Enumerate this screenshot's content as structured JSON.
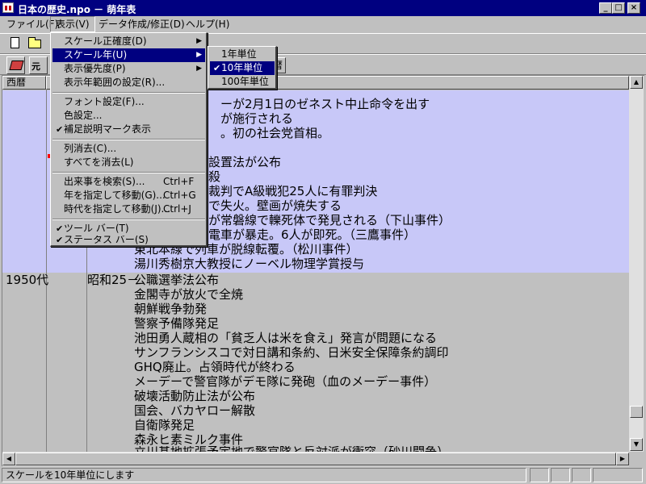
{
  "window": {
    "title": "日本の歴史.npo － 萌年表",
    "min_glyph": "_",
    "max_glyph": "□",
    "close_glyph": "×"
  },
  "menubar": [
    {
      "label": "ファイル(F)"
    },
    {
      "label": "表示(V)"
    },
    {
      "label": "データ作成/修正(D)"
    },
    {
      "label": "ヘルプ(H)"
    }
  ],
  "toolbar": {
    "era_button_label": "元",
    "era_button_right": "暦"
  },
  "columns": {
    "seireki": "西暦"
  },
  "timeline": {
    "rows_1940s": [
      "ーが2月1日のゼネスト中止命令を出す",
      "が施行される",
      "。初の社会党首相。",
      "設置法が公布",
      "殺",
      "裁判でA級戦犯25人に有罪判決",
      "で失火。壁画が焼失する",
      "が常磐線で轢死体で発見される（下山事件）",
      "電車が暴走。6人が即死。（三鷹事件）",
      "東北本線で列車が脱線転覆。（松川事件）",
      "湯川秀樹京大教授にノーベル物理学賞授与"
    ],
    "decade_1950": "1950代",
    "era_1950": "昭和25－",
    "rows_1950s": [
      "公職選挙法公布",
      "金閣寺が放火で全焼",
      "朝鮮戦争勃発",
      "警察予備隊発足",
      "池田勇人蔵相の「貧乏人は米を食え」発言が問題になる",
      "サンフランシスコで対日講和条約、日米安全保障条約調印",
      "GHQ廃止。占領時代が終わる",
      "メーデーで警官隊がデモ隊に発砲（血のメーデー事件）",
      "破壊活動防止法が公布",
      "国会、バカヤロー解散",
      "自衛隊発足",
      "森永ヒ素ミルク事件",
      "立川基地拡張予定地で警官隊と反対派が衝突（砂川闘争）"
    ]
  },
  "view_menu": {
    "items": [
      {
        "label": "スケール正確度(D)",
        "arrow": "▶"
      },
      {
        "label": "スケール年(U)",
        "arrow": "▶"
      },
      {
        "label": "表示優先度(P)",
        "arrow": "▶"
      },
      {
        "label": "表示年範囲の設定(R)..."
      },
      {
        "label": "フォント設定(F)..."
      },
      {
        "label": "色設定..."
      },
      {
        "label": "補足説明マーク表示",
        "check": "✔"
      },
      {
        "label": "列消去(C)..."
      },
      {
        "label": "すべてを消去(L)"
      },
      {
        "label": "出来事を検索(S)...",
        "shortcut": "Ctrl+F"
      },
      {
        "label": "年を指定して移動(G)...",
        "shortcut": "Ctrl+G"
      },
      {
        "label": "時代を指定して移動(J)...",
        "shortcut": "Ctrl+J"
      },
      {
        "label": "ツール バー(T)",
        "check": "✔"
      },
      {
        "label": "ステータス バー(S)",
        "check": "✔"
      }
    ]
  },
  "scale_submenu": {
    "items": [
      {
        "label": "1年単位"
      },
      {
        "label": "10年単位",
        "check": "✔"
      },
      {
        "label": "100年単位"
      }
    ]
  },
  "statusbar": {
    "message": "スケールを10年単位にします"
  },
  "colors": {
    "title_bar": "#000080",
    "highlight_band": "#c8c8f8",
    "menu_selection": "#000080",
    "mark": "#ff0000"
  },
  "icons": {
    "new": "new-document-icon",
    "open": "open-folder-icon",
    "book": "book-icon"
  }
}
